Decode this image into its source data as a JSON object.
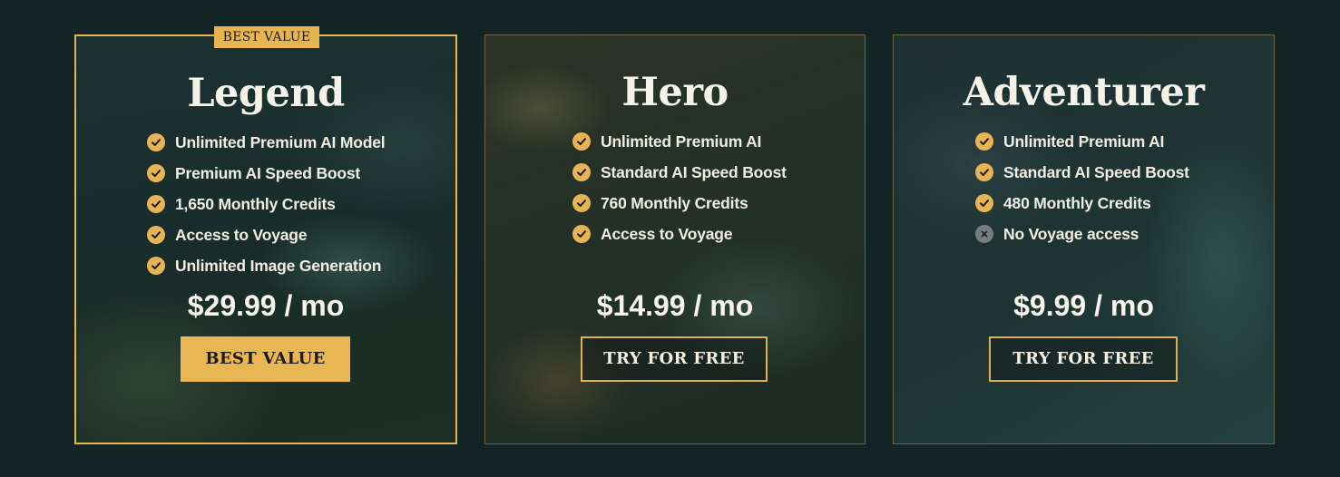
{
  "colors": {
    "background": "#142424",
    "accent": "#e7b550",
    "check_icon": "#e6b455",
    "cross_icon": "#777f7e"
  },
  "plans": [
    {
      "name": "Legend",
      "badge": "BEST VALUE",
      "features": [
        {
          "text": "Unlimited Premium AI Model",
          "icon": "check-icon"
        },
        {
          "text": "Premium AI Speed Boost",
          "icon": "check-icon"
        },
        {
          "text": "1,650 Monthly Credits",
          "icon": "check-icon"
        },
        {
          "text": "Access to Voyage",
          "icon": "check-icon"
        },
        {
          "text": "Unlimited Image Generation",
          "icon": "check-icon"
        }
      ],
      "price": "$29.99 / mo",
      "cta": "BEST VALUE"
    },
    {
      "name": "Hero",
      "features": [
        {
          "text": "Unlimited Premium AI",
          "icon": "check-icon"
        },
        {
          "text": "Standard AI Speed Boost",
          "icon": "check-icon"
        },
        {
          "text": "760 Monthly Credits",
          "icon": "check-icon"
        },
        {
          "text": "Access to Voyage",
          "icon": "check-icon"
        }
      ],
      "price": "$14.99 / mo",
      "cta": "TRY FOR FREE"
    },
    {
      "name": "Adventurer",
      "features": [
        {
          "text": "Unlimited Premium AI",
          "icon": "check-icon"
        },
        {
          "text": "Standard AI Speed Boost",
          "icon": "check-icon"
        },
        {
          "text": "480 Monthly Credits",
          "icon": "check-icon"
        },
        {
          "text": "No Voyage access",
          "icon": "cross-icon"
        }
      ],
      "price": "$9.99 / mo",
      "cta": "TRY FOR FREE"
    }
  ]
}
